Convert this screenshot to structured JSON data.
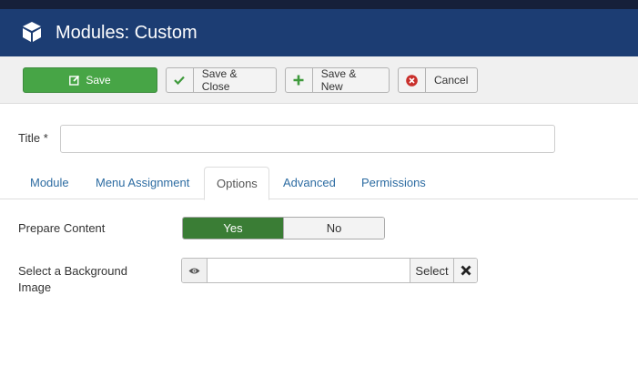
{
  "header": {
    "title": "Modules: Custom",
    "icon": "cube-icon"
  },
  "toolbar": {
    "save_label": "Save",
    "save_close_label": "Save & Close",
    "save_new_label": "Save & New",
    "cancel_label": "Cancel"
  },
  "form": {
    "title_label": "Title *",
    "title_value": ""
  },
  "tabs": [
    {
      "label": "Module"
    },
    {
      "label": "Menu Assignment"
    },
    {
      "label": "Options",
      "active": true
    },
    {
      "label": "Advanced"
    },
    {
      "label": "Permissions"
    }
  ],
  "options": {
    "prepare_content_label": "Prepare Content",
    "yes_label": "Yes",
    "no_label": "No",
    "selected": "Yes",
    "background_image_label": "Select a Background Image",
    "background_image_value": "",
    "select_label": "Select"
  },
  "colors": {
    "header": "#1c3d73",
    "save_button": "#47a546",
    "yes_selected": "#3a7d35",
    "tab_link": "#2d6ca2",
    "cancel_icon": "#c9302c"
  }
}
